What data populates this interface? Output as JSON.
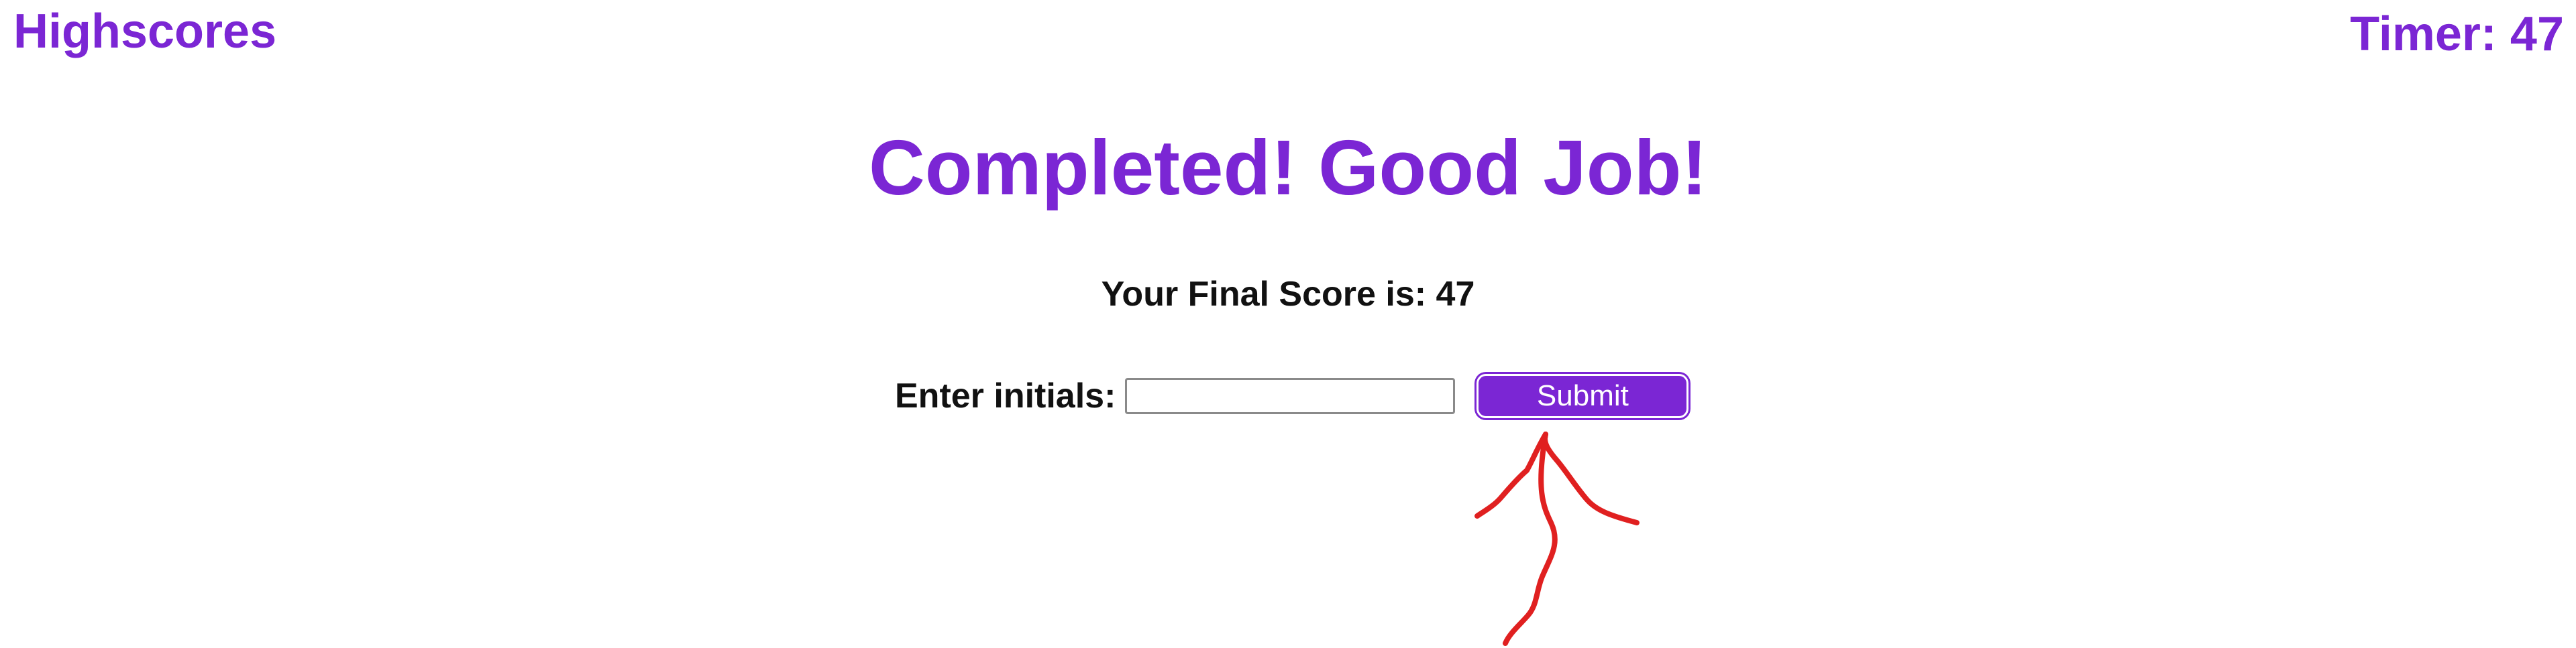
{
  "header": {
    "highscores_label": "Highscores",
    "timer_text": "Timer: 47"
  },
  "main": {
    "heading": "Completed! Good Job!",
    "final_score_text": "Your Final Score is: 47"
  },
  "form": {
    "initials_label": "Enter initials:",
    "initials_value": "",
    "submit_label": "Submit"
  },
  "colors": {
    "accent": "#7b26d4",
    "annotation": "#e02020"
  },
  "annotation": {
    "icon": "hand-drawn-arrow-icon"
  }
}
